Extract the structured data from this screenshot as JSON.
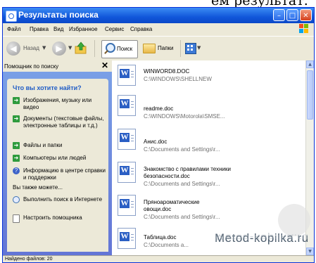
{
  "top_text": "ем результат.",
  "window": {
    "title": "Результаты поиска",
    "buttons": {
      "minimize": "–",
      "maximize": "□",
      "close": "✕"
    }
  },
  "menubar": {
    "items": [
      "Файл",
      "Правка",
      "Вид",
      "Избранное",
      "Сервис",
      "Справка"
    ]
  },
  "toolbar": {
    "back_label": "Назад",
    "back_arrow": "◀",
    "forward_arrow": "▶",
    "dropdown": "▼",
    "search_label": "Поиск",
    "folders_label": "Папки"
  },
  "left_pane": {
    "header": "Помощник по поиску",
    "close": "✕",
    "question": "Что вы хотите найти?",
    "options": [
      {
        "icon": "green-arrow-icon",
        "label": "Изображения, музыку или видео"
      },
      {
        "icon": "green-arrow-icon",
        "label": "Документы (текстовые файлы, электронные таблицы и т.д.)"
      },
      {
        "icon": "green-arrow-icon",
        "label": "Файлы и папки"
      },
      {
        "icon": "green-arrow-icon",
        "label": "Компьютеры или людей"
      },
      {
        "icon": "help-icon",
        "label": "Информацию в центре справки и поддержки"
      }
    ],
    "also_heading": "Вы также можете...",
    "also_items": [
      {
        "icon": "internet-search-icon",
        "label": "Выполнить поиск в Интернете"
      },
      {
        "icon": "settings-doc-icon",
        "label": "Настроить помощника"
      }
    ]
  },
  "files": [
    {
      "name": "WINWORD8.DOC",
      "path": "C:\\WINDOWS\\SHELLNEW"
    },
    {
      "name": "readme.doc",
      "path": "C:\\WINDOWS\\Motorola\\SMSE..."
    },
    {
      "name": "Анис.doc",
      "path": "C:\\Documents and Settings\\r..."
    },
    {
      "name": "Знакомство с правилами техники безопасности.doc",
      "path": "C:\\Documents and Settings\\r..."
    },
    {
      "name": "Пряноароматические овощи.doc",
      "path": "C:\\Documents and Settings\\r..."
    },
    {
      "name": "Таблица.doc",
      "path": "C:\\Documents a..."
    }
  ],
  "file_icon_letter": "W",
  "scroll": {
    "up": "▲",
    "down": "▼"
  },
  "status": "Найдено файлов: 20",
  "watermark": "Metod-kopilka.ru"
}
